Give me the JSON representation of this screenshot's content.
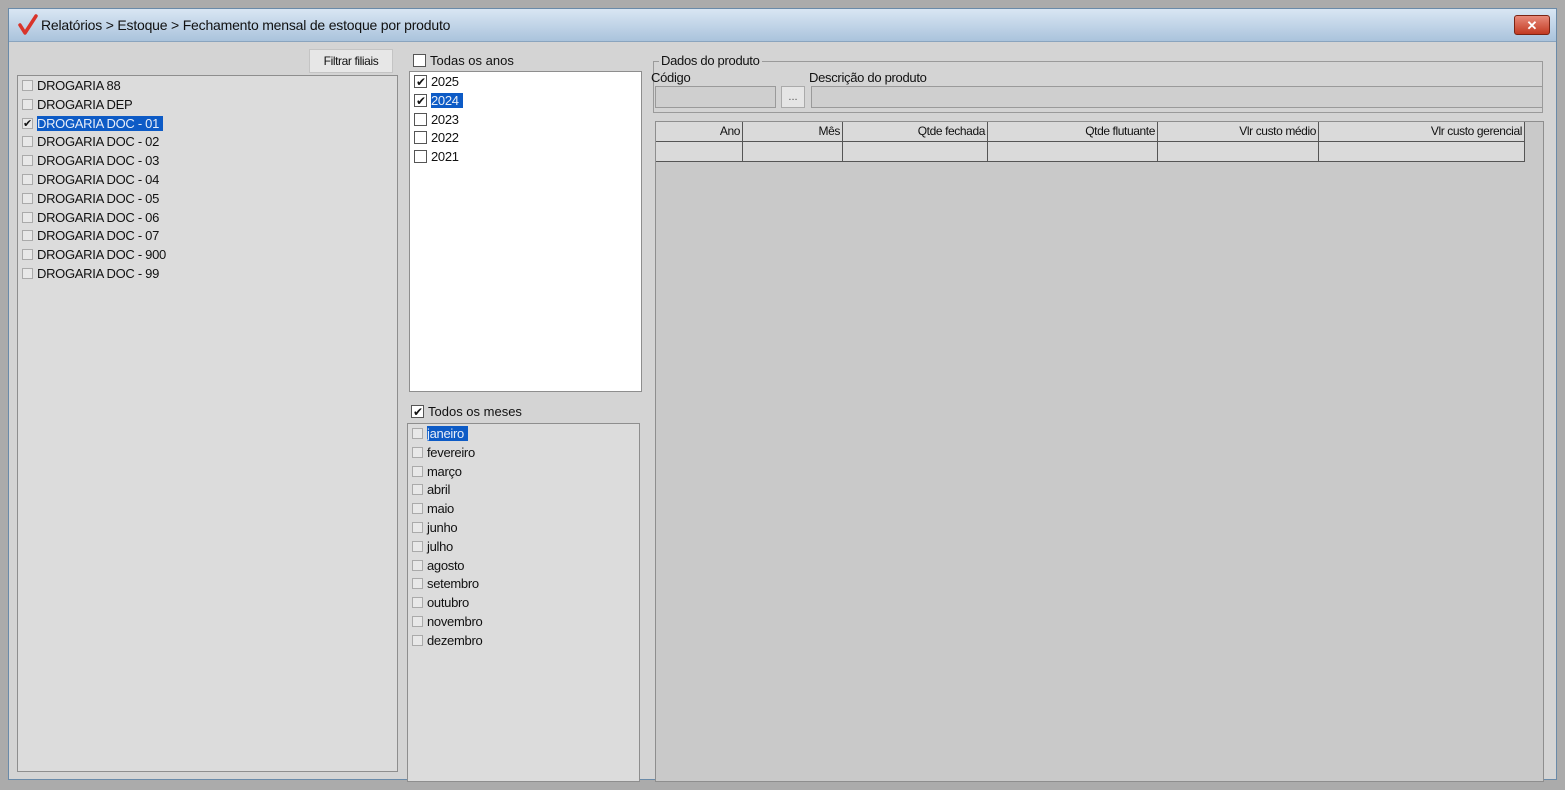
{
  "window": {
    "title": "Relatórios > Estoque > Fechamento mensal de estoque por produto",
    "close_label": "✕"
  },
  "filiais": {
    "button_label": "Filtrar filiais",
    "items": [
      {
        "label": "DROGARIA 88",
        "checked": false,
        "selected": false
      },
      {
        "label": "DROGARIA DEP",
        "checked": false,
        "selected": false
      },
      {
        "label": "DROGARIA DOC - 01",
        "checked": true,
        "selected": true
      },
      {
        "label": "DROGARIA DOC - 02",
        "checked": false,
        "selected": false
      },
      {
        "label": "DROGARIA DOC - 03",
        "checked": false,
        "selected": false
      },
      {
        "label": "DROGARIA DOC - 04",
        "checked": false,
        "selected": false
      },
      {
        "label": "DROGARIA DOC - 05",
        "checked": false,
        "selected": false
      },
      {
        "label": "DROGARIA DOC - 06",
        "checked": false,
        "selected": false
      },
      {
        "label": "DROGARIA DOC - 07",
        "checked": false,
        "selected": false
      },
      {
        "label": "DROGARIA DOC - 900",
        "checked": false,
        "selected": false
      },
      {
        "label": "DROGARIA DOC - 99",
        "checked": false,
        "selected": false
      }
    ]
  },
  "anos": {
    "all_label": "Todas os anos",
    "all_checked": false,
    "items": [
      {
        "label": "2025",
        "checked": true,
        "selected": false
      },
      {
        "label": "2024",
        "checked": true,
        "selected": true
      },
      {
        "label": "2023",
        "checked": false,
        "selected": false
      },
      {
        "label": "2022",
        "checked": false,
        "selected": false
      },
      {
        "label": "2021",
        "checked": false,
        "selected": false
      }
    ]
  },
  "meses": {
    "all_label": "Todos os meses",
    "all_checked": true,
    "items": [
      {
        "label": "janeiro",
        "checked": false,
        "selected": true
      },
      {
        "label": "fevereiro",
        "checked": false,
        "selected": false
      },
      {
        "label": "março",
        "checked": false,
        "selected": false
      },
      {
        "label": "abril",
        "checked": false,
        "selected": false
      },
      {
        "label": "maio",
        "checked": false,
        "selected": false
      },
      {
        "label": "junho",
        "checked": false,
        "selected": false
      },
      {
        "label": "julho",
        "checked": false,
        "selected": false
      },
      {
        "label": "agosto",
        "checked": false,
        "selected": false
      },
      {
        "label": "setembro",
        "checked": false,
        "selected": false
      },
      {
        "label": "outubro",
        "checked": false,
        "selected": false
      },
      {
        "label": "novembro",
        "checked": false,
        "selected": false
      },
      {
        "label": "dezembro",
        "checked": false,
        "selected": false
      }
    ]
  },
  "produto": {
    "group_title": "Dados do produto",
    "codigo_label": "Código",
    "codigo_value": "",
    "lookup_label": "...",
    "descricao_label": "Descrição do produto",
    "descricao_value": ""
  },
  "grid": {
    "columns": [
      "Ano",
      "Mês",
      "Qtde fechada",
      "Qtde flutuante",
      "Vlr custo médio",
      "Vlr custo gerencial"
    ]
  },
  "colors": {
    "selection": "#0d5bc6",
    "close_button": "#c23a22",
    "title_icon": "#d9342b"
  }
}
